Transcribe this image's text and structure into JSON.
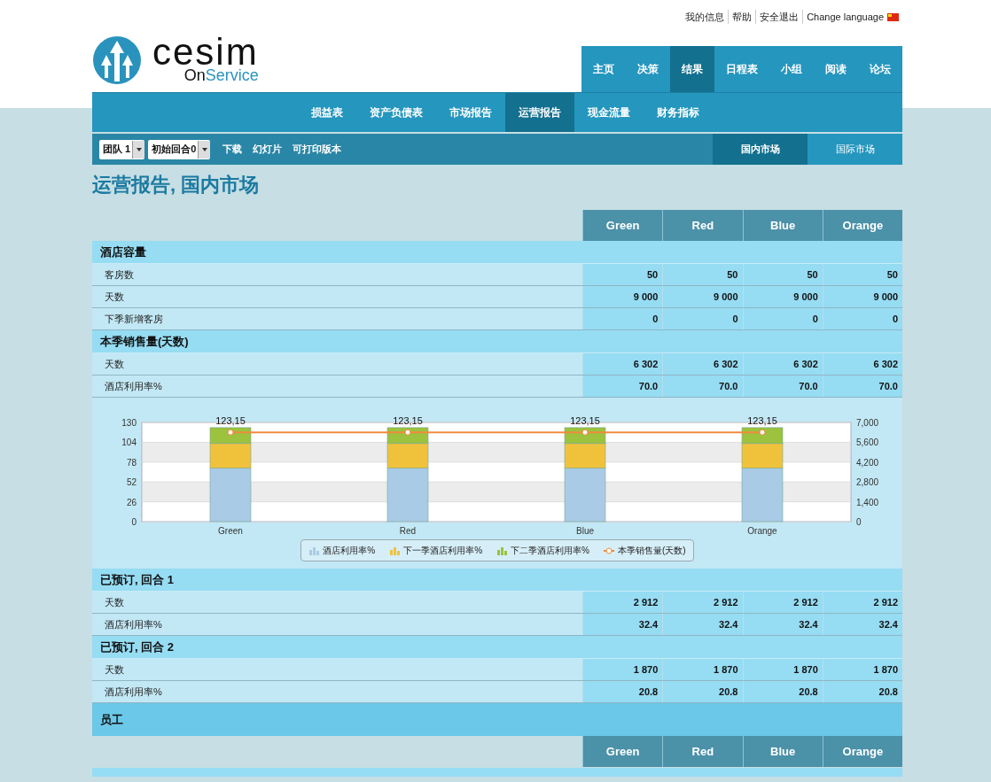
{
  "top_links": [
    "我的信息",
    "帮助",
    "安全退出",
    "Change language"
  ],
  "logo": {
    "word": "cesim",
    "sub_a": "On",
    "sub_b": "Service"
  },
  "main_nav": [
    {
      "label": "主页",
      "selected": false
    },
    {
      "label": "决策",
      "selected": false
    },
    {
      "label": "结果",
      "selected": true
    },
    {
      "label": "日程表",
      "selected": false
    },
    {
      "label": "小组",
      "selected": false
    },
    {
      "label": "阅读",
      "selected": false
    },
    {
      "label": "论坛",
      "selected": false
    }
  ],
  "sub_nav": [
    {
      "label": "损益表",
      "selected": false
    },
    {
      "label": "资产负债表",
      "selected": false
    },
    {
      "label": "市场报告",
      "selected": false
    },
    {
      "label": "运营报告",
      "selected": true
    },
    {
      "label": "现金流量",
      "selected": false
    },
    {
      "label": "财务指标",
      "selected": false
    }
  ],
  "toolbar": {
    "selects": [
      "团队 1",
      "初始回合0"
    ],
    "links": [
      "下载",
      "幻灯片",
      "可打印版本"
    ],
    "market_tabs": [
      {
        "label": "国内市场",
        "selected": true
      },
      {
        "label": "国际市场",
        "selected": false
      }
    ]
  },
  "title": "运营报告, 国内市场",
  "blocks": [
    {
      "kind": "header",
      "columns": [
        "Green",
        "Red",
        "Blue",
        "Orange"
      ]
    },
    {
      "kind": "section",
      "title": "酒店容量"
    },
    {
      "kind": "row",
      "label": "客房数",
      "values": [
        "50",
        "50",
        "50",
        "50"
      ]
    },
    {
      "kind": "row",
      "label": "天数",
      "values": [
        "9 000",
        "9 000",
        "9 000",
        "9 000"
      ]
    },
    {
      "kind": "row",
      "label": "下季新增客房",
      "values": [
        "0",
        "0",
        "0",
        "0"
      ]
    },
    {
      "kind": "section",
      "title": "本季销售量(天数)"
    },
    {
      "kind": "row",
      "label": "天数",
      "values": [
        "6 302",
        "6 302",
        "6 302",
        "6 302"
      ]
    },
    {
      "kind": "row",
      "label": "酒店利用率%",
      "values": [
        "70.0",
        "70.0",
        "70.0",
        "70.0"
      ]
    },
    {
      "kind": "chart",
      "chart_data": {
        "type": "bar",
        "stacked": true,
        "categories": [
          "Green",
          "Red",
          "Blue",
          "Orange"
        ],
        "series": [
          {
            "name": "酒店利用率%",
            "color": "#a9cbe6",
            "values": [
              70.0,
              70.0,
              70.0,
              70.0
            ]
          },
          {
            "name": "下一季酒店利用率%",
            "color": "#f0c23c",
            "values": [
              32.4,
              32.4,
              32.4,
              32.4
            ]
          },
          {
            "name": "下二季酒店利用率%",
            "color": "#9cc23e",
            "values": [
              20.8,
              20.8,
              20.8,
              20.8
            ]
          },
          {
            "name": "本季销售量(天数)",
            "color": "#f08a3c",
            "type": "line",
            "axis": "y2",
            "marker": "circle",
            "values": [
              6302,
              6302,
              6302,
              6302
            ]
          }
        ],
        "ylim": [
          0,
          130
        ],
        "yticks": [
          0,
          26,
          52,
          78,
          104,
          130
        ],
        "y2lim": [
          0,
          7000
        ],
        "y2ticks": [
          {
            "value": 0,
            "label": "0"
          },
          {
            "value": 1400,
            "label": "1,400"
          },
          {
            "value": 2800,
            "label": "2,800"
          },
          {
            "value": 4200,
            "label": "4,200"
          },
          {
            "value": 5600,
            "label": "5,600"
          },
          {
            "value": 7000,
            "label": "7,000"
          }
        ],
        "annotations": [
          "123,15",
          "123,15",
          "123,15",
          "123,15"
        ],
        "grid": true,
        "legend": "bottom"
      }
    },
    {
      "kind": "section",
      "title": "已预订, 回合 1"
    },
    {
      "kind": "row",
      "label": "天数",
      "values": [
        "2 912",
        "2 912",
        "2 912",
        "2 912"
      ]
    },
    {
      "kind": "row",
      "label": "酒店利用率%",
      "values": [
        "32.4",
        "32.4",
        "32.4",
        "32.4"
      ]
    },
    {
      "kind": "section",
      "title": "已预订, 回合 2"
    },
    {
      "kind": "row",
      "label": "天数",
      "values": [
        "1 870",
        "1 870",
        "1 870",
        "1 870"
      ]
    },
    {
      "kind": "row",
      "label": "酒店利用率%",
      "values": [
        "20.8",
        "20.8",
        "20.8",
        "20.8"
      ]
    },
    {
      "kind": "group",
      "title": "员工"
    },
    {
      "kind": "header",
      "columns": [
        "Green",
        "Red",
        "Blue",
        "Orange"
      ]
    }
  ]
}
